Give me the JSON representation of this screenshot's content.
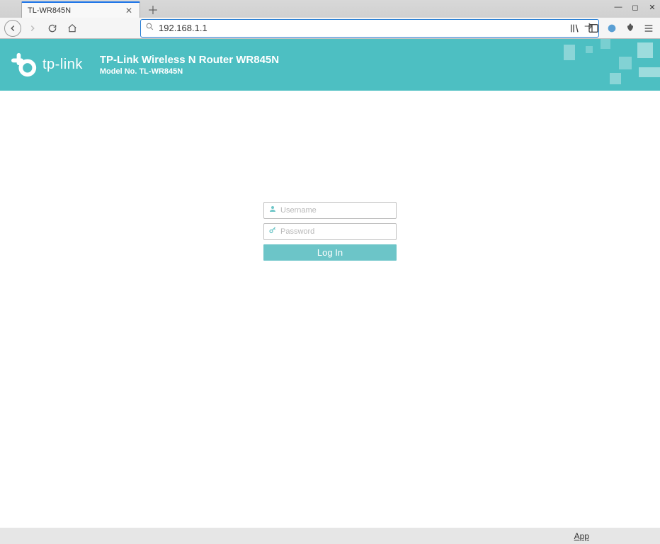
{
  "browser": {
    "tab_title": "TL-WR845N",
    "url": "192.168.1.1"
  },
  "header": {
    "brand": "tp-link",
    "product_title": "TP-Link Wireless N Router WR845N",
    "model_no": "Model No. TL-WR845N"
  },
  "login": {
    "username_placeholder": "Username",
    "password_placeholder": "Password",
    "button_label": "Log In"
  },
  "footer": {
    "link_label": "App"
  }
}
